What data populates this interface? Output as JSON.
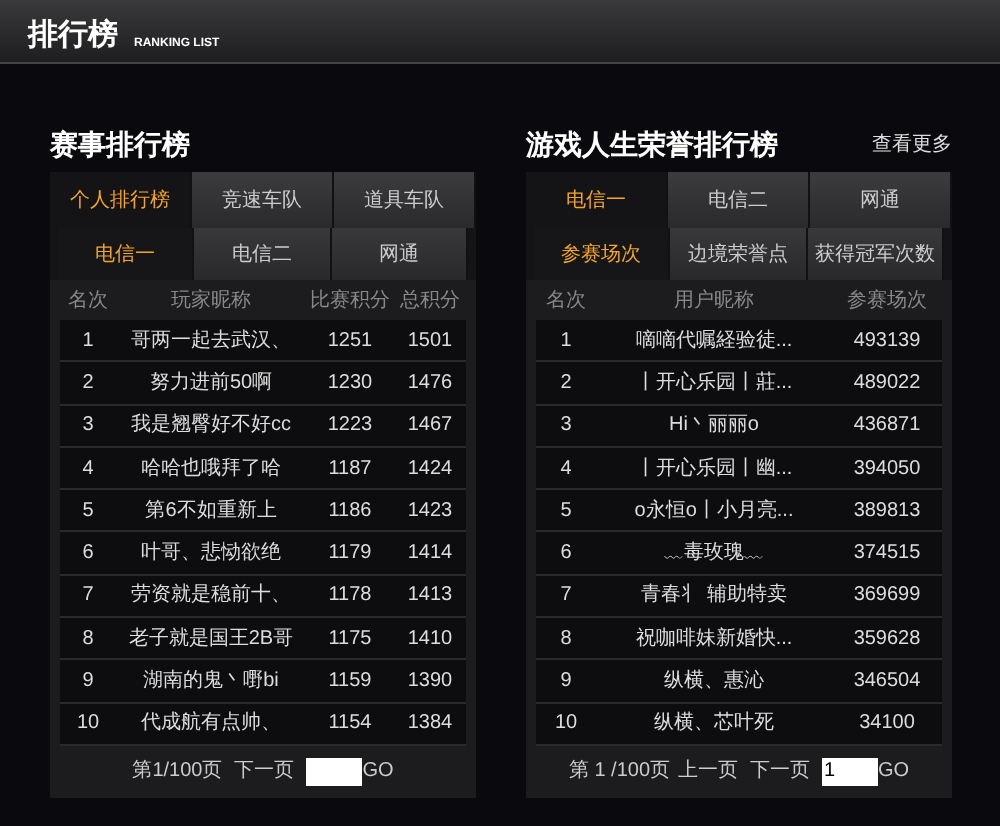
{
  "header": {
    "title": "排行榜",
    "subtitle": "RANKING LIST"
  },
  "panels": [
    {
      "title": "赛事排行榜",
      "tabs": [
        {
          "label": "个人排行榜",
          "selected": true
        },
        {
          "label": "竞速车队",
          "selected": false
        },
        {
          "label": "道具车队",
          "selected": false
        }
      ],
      "subtabs": [
        {
          "label": "电信一",
          "selected": true
        },
        {
          "label": "电信二",
          "selected": false
        },
        {
          "label": "网通",
          "selected": false
        }
      ],
      "columns": [
        "名次",
        "玩家昵称",
        "比赛积分",
        "总积分"
      ],
      "rows": [
        [
          "1",
          "哥两一起去武汉、",
          "1251",
          "1501"
        ],
        [
          "2",
          "努力进前50啊",
          "1230",
          "1476"
        ],
        [
          "3",
          "我是翘臀好不好cc",
          "1223",
          "1467"
        ],
        [
          "4",
          "哈哈也哦拜了哈",
          "1187",
          "1424"
        ],
        [
          "5",
          "第6不如重新上",
          "1186",
          "1423"
        ],
        [
          "6",
          "叶哥、悲恸欲绝",
          "1179",
          "1414"
        ],
        [
          "7",
          "劳资就是稳前十、",
          "1178",
          "1413"
        ],
        [
          "8",
          "老子就是国王2B哥",
          "1175",
          "1410"
        ],
        [
          "9",
          "湖南的鬼丶嘢bi",
          "1159",
          "1390"
        ],
        [
          "10",
          "代成航有点帅、",
          "1154",
          "1384"
        ]
      ],
      "pager": {
        "page": "第1/100页",
        "next": "下一页",
        "go": "GO"
      }
    },
    {
      "title": "游戏人生荣誉排行榜",
      "more": "查看更多",
      "tabs": [
        {
          "label": "电信一",
          "selected": true
        },
        {
          "label": "电信二",
          "selected": false
        },
        {
          "label": "网通",
          "selected": false
        }
      ],
      "subtabs": [
        {
          "label": "参赛场次",
          "selected": true
        },
        {
          "label": "边境荣誉点",
          "selected": false
        },
        {
          "label": "获得冠军次数",
          "selected": false
        }
      ],
      "columns": [
        "名次",
        "用户昵称",
        "参赛场次"
      ],
      "rows": [
        [
          "1",
          "嘀嘀代嘱経验徒...",
          "493139"
        ],
        [
          "2",
          "丨开心乐园丨莊...",
          "489022"
        ],
        [
          "3",
          "Hi丶丽丽o",
          "436871"
        ],
        [
          "4",
          "丨开心乐园丨幽...",
          "394050"
        ],
        [
          "5",
          "o永恒o丨小月亮...",
          "389813"
        ],
        [
          "6",
          "﹏毒玫瑰﹏",
          "374515"
        ],
        [
          "7",
          "青春丬 辅助特卖",
          "369699"
        ],
        [
          "8",
          "祝咖啡妹新婚快...",
          "359628"
        ],
        [
          "9",
          "纵横、惠沁",
          "346504"
        ],
        [
          "10",
          "纵横、芯叶死",
          "34100"
        ]
      ],
      "pager": {
        "page": "第 1 /100页",
        "prev": "上一页",
        "next": "下一页",
        "input": "1",
        "go": "GO"
      }
    }
  ]
}
